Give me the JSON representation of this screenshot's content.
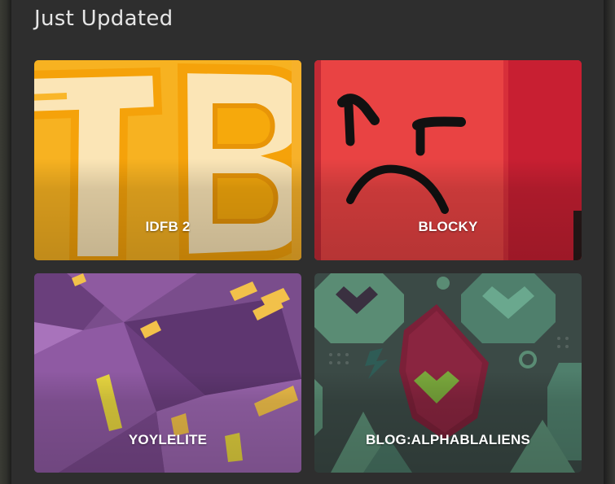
{
  "section": {
    "title": "Just Updated"
  },
  "cards": [
    {
      "title": "IDFB 2",
      "image_icon": "tb-logo-art"
    },
    {
      "title": "BLOCKY",
      "image_icon": "angry-red-block-face"
    },
    {
      "title": "YOYLELITE",
      "image_icon": "purple-crystal-art"
    },
    {
      "title": "BLOG:ALPHABLALIENS",
      "image_icon": "green-hearts-pattern"
    }
  ],
  "colors": {
    "panel_bg": "#2e2e2e",
    "heading_text": "#e6e6e6",
    "card_label": "#ffffff"
  }
}
